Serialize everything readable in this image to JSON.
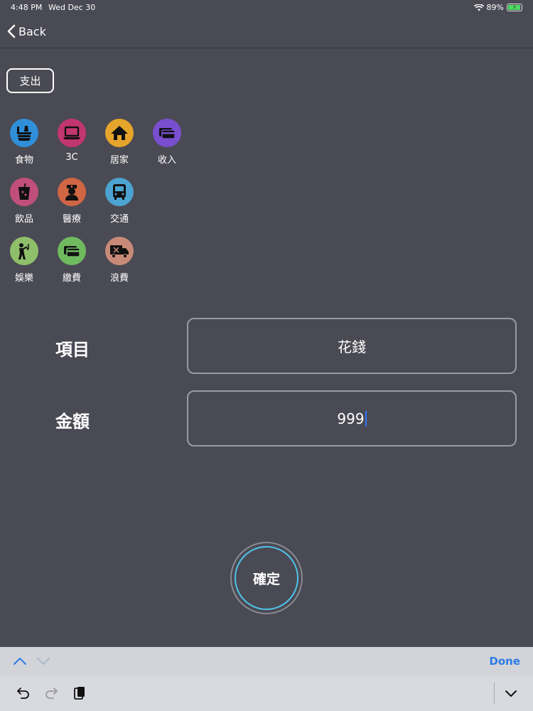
{
  "status_bar": {
    "time": "4:48 PM",
    "date": "Wed Dec 30",
    "battery": "89%"
  },
  "nav": {
    "back_label": "Back"
  },
  "type_button": {
    "label": "支出"
  },
  "categories": [
    {
      "label": "食物",
      "icon": "food-icon",
      "color": "#2f8fd8"
    },
    {
      "label": "3C",
      "icon": "laptop-icon",
      "color": "#c2366f"
    },
    {
      "label": "居家",
      "icon": "home-icon",
      "color": "#e4a52a"
    },
    {
      "label": "收入",
      "icon": "wallet-icon",
      "color": "#7a4fcf"
    },
    {
      "label": "飲品",
      "icon": "drink-icon",
      "color": "#c04f7c"
    },
    {
      "label": "醫療",
      "icon": "nurse-icon",
      "color": "#cf6644"
    },
    {
      "label": "交通",
      "icon": "bus-icon",
      "color": "#4ca3d0"
    },
    {
      "label": "娛樂",
      "icon": "music-person-icon",
      "color": "#8fbf6a"
    },
    {
      "label": "繳費",
      "icon": "card-icon",
      "color": "#6fb95f"
    },
    {
      "label": "浪費",
      "icon": "truck-icon",
      "color": "#c88a78"
    }
  ],
  "form": {
    "item_label": "項目",
    "item_value": "花錢",
    "amount_label": "金額",
    "amount_value": "999"
  },
  "confirm": {
    "label": "確定"
  },
  "keyboard": {
    "done_label": "Done"
  }
}
